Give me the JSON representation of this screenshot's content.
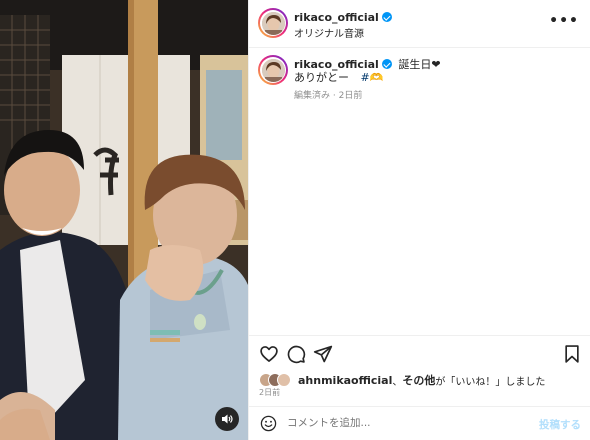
{
  "post": {
    "username": "rikaco_official",
    "audio_label": "オリジナル音源",
    "caption_line1": "誕生日❤︎",
    "caption_line2": "ありがとー",
    "hashtag": "#🫶",
    "edited_label": "編集済み",
    "age": "2日前"
  },
  "likes": {
    "liker": "ahnmikaofficial",
    "others": "その他",
    "suffix": "が「いいね！」しました",
    "separator": "、"
  },
  "date": "2日前",
  "comment": {
    "placeholder": "コメントを追加...",
    "post_label": "投稿する"
  },
  "colors": {
    "accent": "#0095f6",
    "post_button_disabled": "#b2dffc",
    "meta_text": "#8e8e8e"
  },
  "icons": [
    "volume-icon",
    "verified-badge-icon",
    "more-options-icon",
    "heart-icon",
    "comment-icon",
    "share-icon",
    "bookmark-icon",
    "emoji-icon"
  ]
}
